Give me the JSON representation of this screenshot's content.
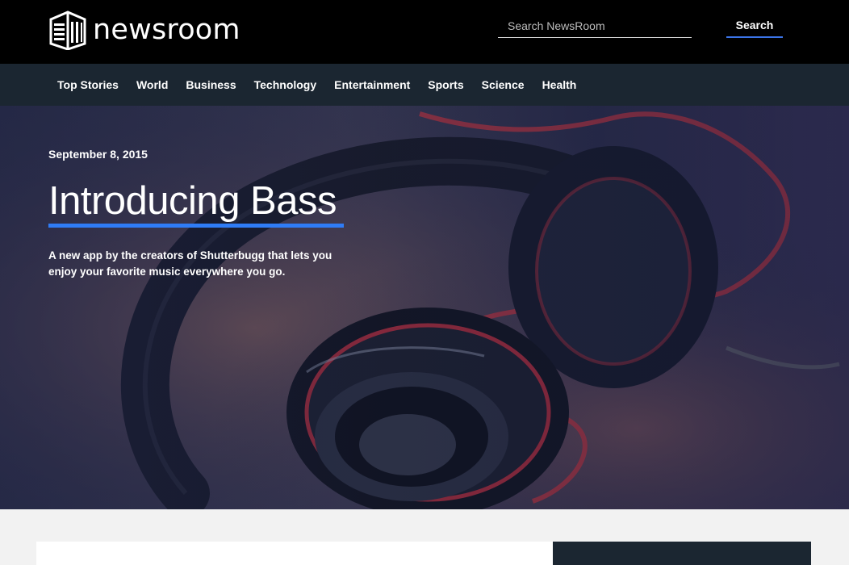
{
  "header": {
    "brand": "newsroom",
    "search": {
      "placeholder": "Search NewsRoom",
      "value": "",
      "button_label": "Search"
    }
  },
  "nav": {
    "items": [
      {
        "label": "Top Stories"
      },
      {
        "label": "World"
      },
      {
        "label": "Business"
      },
      {
        "label": "Technology"
      },
      {
        "label": "Entertainment"
      },
      {
        "label": "Sports"
      },
      {
        "label": "Science"
      },
      {
        "label": "Health"
      }
    ]
  },
  "hero": {
    "date": "September 8, 2015",
    "title": "Introducing Bass",
    "description": "A new app by the creators of Shutterbugg that lets you enjoy your favorite music everywhere you go.",
    "image_icon": "headphones-photo"
  },
  "colors": {
    "header_bg": "#000000",
    "nav_bg": "#1b2631",
    "accent": "#2f7cf6",
    "page_bg": "#f2f2f2"
  }
}
